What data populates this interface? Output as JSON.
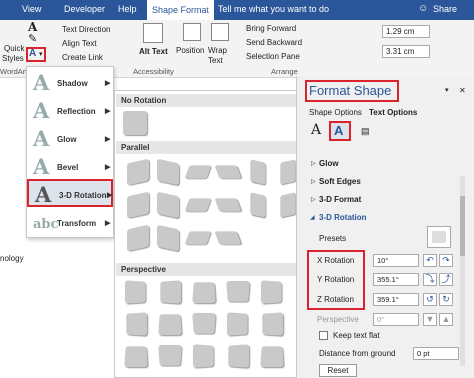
{
  "ribbon_tabs": {
    "view": "View",
    "developer": "Developer",
    "help": "Help",
    "shape_format": "Shape Format",
    "tell_me": "Tell me what you want to do",
    "share": "Share"
  },
  "ribbon": {
    "quick_label": "Quick",
    "styles_label": "Styles",
    "wordart_label": "WordArt S",
    "text_direction": "Text Direction",
    "align_text": "Align Text",
    "create_link": "Create Link",
    "alt_text": "Alt Text",
    "accessibility": "Accessibility",
    "position": "Position",
    "wrap_text": "Wrap Text",
    "bring_forward": "Bring Forward",
    "send_backward": "Send Backward",
    "selection_pane": "Selection Pane",
    "arrange": "Arrange",
    "height_value": "1.29 cm",
    "width_value": "3.31 cm"
  },
  "effects_menu": {
    "items": [
      {
        "label": "Shadow"
      },
      {
        "label": "Reflection"
      },
      {
        "label": "Glow"
      },
      {
        "label": "Bevel"
      },
      {
        "label": "3-D Rotation"
      },
      {
        "label": "Transform"
      }
    ]
  },
  "gallery": {
    "no_rotation": "No Rotation",
    "parallel": "Parallel",
    "perspective": "Perspective"
  },
  "document": {
    "fragment": "nology"
  },
  "format_pane": {
    "title": "Format Shape",
    "tab_shape_options": "Shape Options",
    "tab_text_options": "Text Options",
    "glow": "Glow",
    "soft_edges": "Soft Edges",
    "format_3d": "3-D Format",
    "rotation_3d": "3-D Rotation",
    "presets": "Presets",
    "x_rotation_label": "X Rotation",
    "x_rotation_value": "10°",
    "y_rotation_label": "Y Rotation",
    "y_rotation_value": "355.1°",
    "z_rotation_label": "Z Rotation",
    "z_rotation_value": "359.1°",
    "perspective_label": "Perspective",
    "perspective_value": "0°",
    "keep_text_flat": "Keep text flat",
    "distance_label": "Distance from ground",
    "distance_value": "0 pt",
    "reset": "Reset"
  },
  "colors": {
    "accent": "#2b579a",
    "highlight_red": "#d9232e"
  }
}
